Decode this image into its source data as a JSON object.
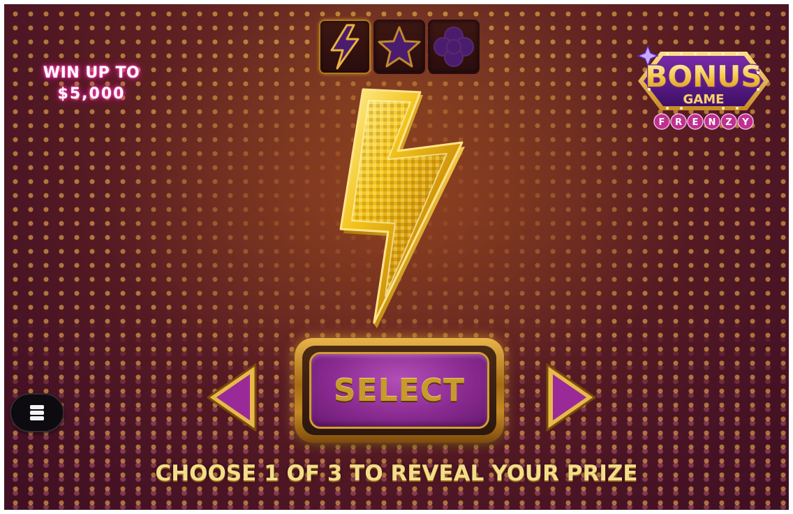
{
  "win_up_to": {
    "label": "WIN UP TO",
    "amount": "$5,000"
  },
  "symbol_tabs": [
    {
      "icon": "lightning-bolt-icon",
      "selected": true
    },
    {
      "icon": "star-icon",
      "selected": false
    },
    {
      "icon": "clover-icon",
      "selected": false
    }
  ],
  "logo": {
    "line1": "BONUS",
    "line2": "GAME",
    "line3_letters": [
      "F",
      "R",
      "E",
      "N",
      "Z",
      "Y"
    ]
  },
  "featured_symbol": "lightning-bolt-icon",
  "select_button": {
    "label": "SELECT"
  },
  "navigation": {
    "left_icon": "arrow-left-icon",
    "right_icon": "arrow-right-icon"
  },
  "menu": {
    "icon": "menu-icon"
  },
  "instruction": "CHOOSE 1 OF 3 TO REVEAL YOUR PRIZE",
  "colors": {
    "gold": "#e7b94a",
    "purple": "#8a2b92",
    "pink_glow": "#ff3fae"
  }
}
